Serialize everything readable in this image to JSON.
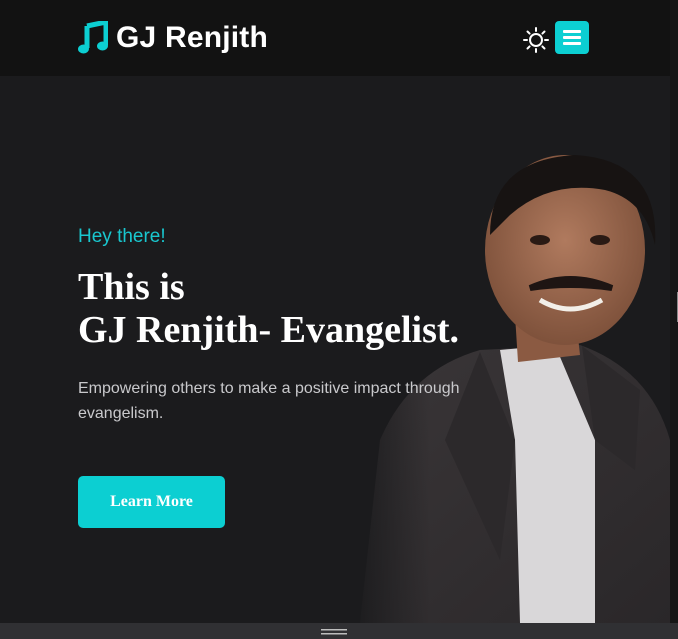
{
  "header": {
    "brand_name": "GJ Renjith",
    "brand_icon": "music-note-icon",
    "theme_toggle_icon": "sun-icon",
    "menu_icon": "hamburger-menu-icon"
  },
  "hero": {
    "greeting": "Hey there!",
    "headline_line1": "This is",
    "headline_name": "GJ Renjith- ",
    "headline_role": "Evangelist.",
    "description": "Empowering others to make a positive impact through evangelism.",
    "cta_label": "Learn More"
  },
  "colors": {
    "accent": "#0ccfd2",
    "header_bg": "#121212",
    "page_bg": "#1b1b1d",
    "text_primary": "#ffffff",
    "text_muted": "#c9c9cc"
  }
}
